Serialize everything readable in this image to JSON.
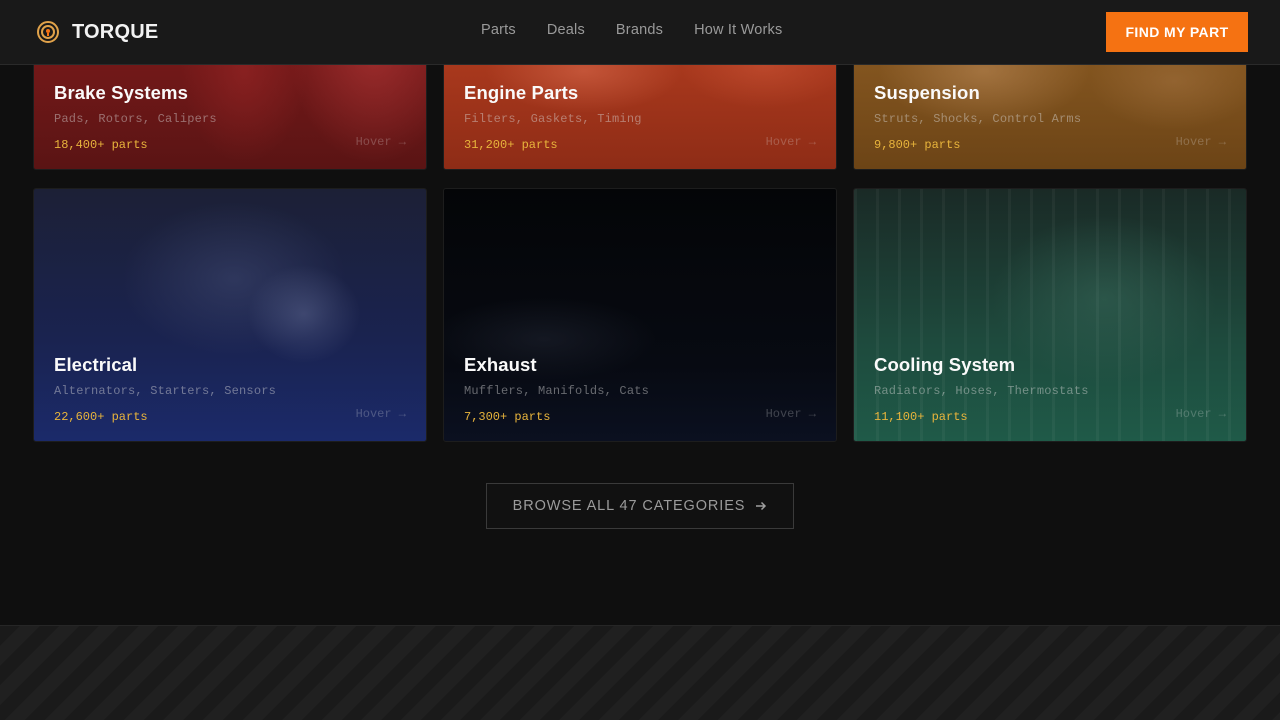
{
  "header": {
    "brand": "TORQUE",
    "logo_icon": "gear-icon",
    "nav": [
      "Parts",
      "Deals",
      "Brands",
      "How It Works"
    ],
    "cta": "FIND MY PART",
    "cta_color": "#f57212"
  },
  "cards": [
    {
      "title": "Brake Systems",
      "subtitle": "Pads, Rotors, Calipers",
      "count": "18,400+ parts",
      "hover": "Hover →",
      "tint": "#8a1e1e"
    },
    {
      "title": "Engine Parts",
      "subtitle": "Filters, Gaskets, Timing",
      "count": "31,200+ parts",
      "hover": "Hover →",
      "tint": "#a6341a"
    },
    {
      "title": "Suspension",
      "subtitle": "Struts, Shocks, Control Arms",
      "count": "9,800+ parts",
      "hover": "Hover →",
      "tint": "#8a5a1c"
    },
    {
      "title": "Electrical",
      "subtitle": "Alternators, Starters, Sensors",
      "count": "22,600+ parts",
      "hover": "Hover →",
      "tint": "#1b2a6a"
    },
    {
      "title": "Exhaust",
      "subtitle": "Mufflers, Manifolds, Cats",
      "count": "7,300+ parts",
      "hover": "Hover →",
      "tint": "#05070c"
    },
    {
      "title": "Cooling System",
      "subtitle": "Radiators, Hoses, Thermostats",
      "count": "11,100+ parts",
      "hover": "Hover →",
      "tint": "#1f5a48"
    }
  ],
  "browse": {
    "label": "BROWSE ALL 47 CATEGORIES",
    "icon": "arrow-right-icon"
  },
  "colors": {
    "accent": "#f57212",
    "count_text": "#e8b43c",
    "page_bg": "#0f0f0f"
  }
}
